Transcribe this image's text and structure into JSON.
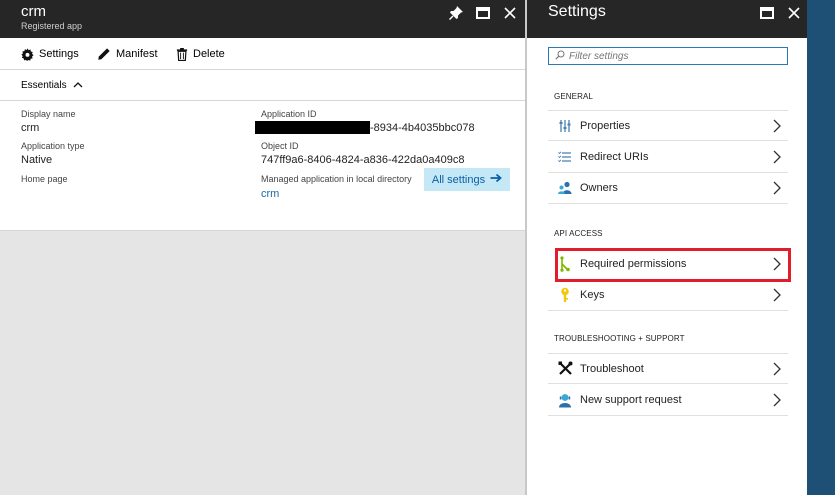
{
  "left_blade": {
    "title": "crm",
    "subtitle": "Registered app",
    "commands": {
      "settings": "Settings",
      "manifest": "Manifest",
      "delete": "Delete"
    },
    "essentials_label": "Essentials",
    "fields": {
      "display_name_label": "Display name",
      "display_name_value": "crm",
      "application_type_label": "Application type",
      "application_type_value": "Native",
      "home_page_label": "Home page",
      "application_id_label": "Application ID",
      "application_id_value": "-8934-4b4035bbc078",
      "object_id_label": "Object ID",
      "object_id_value": "747ff9a6-8406-4824-a836-422da0a409c8",
      "managed_app_label": "Managed application in local directory",
      "managed_app_value": "crm"
    },
    "all_settings_label": "All settings"
  },
  "right_blade": {
    "title": "Settings",
    "filter_placeholder": "Filter settings",
    "sections": {
      "general": "GENERAL",
      "api_access": "API ACCESS",
      "troubleshooting": "TROUBLESHOOTING + SUPPORT"
    },
    "items": {
      "properties": "Properties",
      "redirect_uris": "Redirect URIs",
      "owners": "Owners",
      "required_permissions": "Required permissions",
      "keys": "Keys",
      "troubleshoot": "Troubleshoot",
      "new_support_request": "New support request"
    }
  },
  "colors": {
    "header_bg": "#262626",
    "highlight_border": "#e11d2b",
    "accent_blue": "#1b6aa7"
  }
}
